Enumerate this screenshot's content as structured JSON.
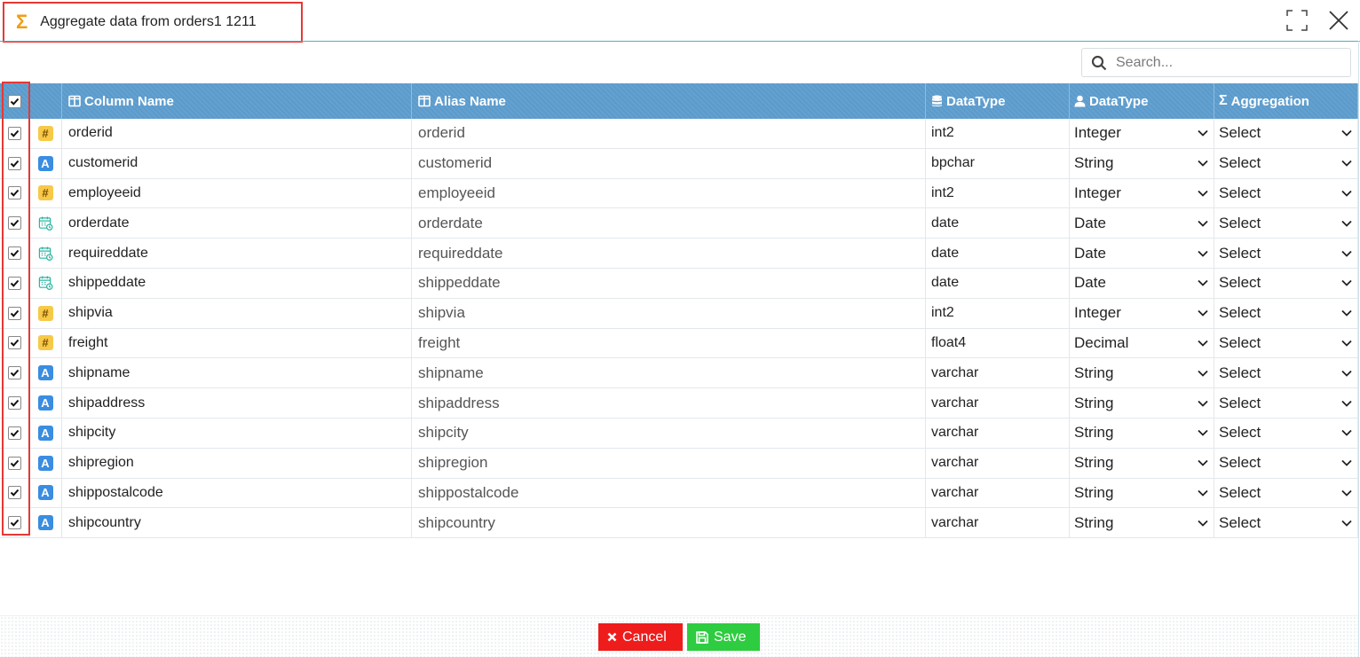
{
  "dialog": {
    "title": "Aggregate data from orders1 1211"
  },
  "search": {
    "placeholder": "Search..."
  },
  "table": {
    "headers": {
      "column_name": "Column Name",
      "alias_name": "Alias Name",
      "data_type": "DataType",
      "data_type2": "DataType",
      "aggregation": "Aggregation"
    },
    "rows": [
      {
        "type_icon": "hash-icon",
        "column": "orderid",
        "alias": "orderid",
        "db_type": "int2",
        "data_type": "Integer",
        "aggregation": "Select"
      },
      {
        "type_icon": "string-icon",
        "column": "customerid",
        "alias": "customerid",
        "db_type": "bpchar",
        "data_type": "String",
        "aggregation": "Select"
      },
      {
        "type_icon": "hash-icon",
        "column": "employeeid",
        "alias": "employeeid",
        "db_type": "int2",
        "data_type": "Integer",
        "aggregation": "Select"
      },
      {
        "type_icon": "calendar-icon",
        "column": "orderdate",
        "alias": "orderdate",
        "db_type": "date",
        "data_type": "Date",
        "aggregation": "Select"
      },
      {
        "type_icon": "calendar-icon",
        "column": "requireddate",
        "alias": "requireddate",
        "db_type": "date",
        "data_type": "Date",
        "aggregation": "Select"
      },
      {
        "type_icon": "calendar-icon",
        "column": "shippeddate",
        "alias": "shippeddate",
        "db_type": "date",
        "data_type": "Date",
        "aggregation": "Select"
      },
      {
        "type_icon": "hash-icon",
        "column": "shipvia",
        "alias": "shipvia",
        "db_type": "int2",
        "data_type": "Integer",
        "aggregation": "Select"
      },
      {
        "type_icon": "hash-icon",
        "column": "freight",
        "alias": "freight",
        "db_type": "float4",
        "data_type": "Decimal",
        "aggregation": "Select"
      },
      {
        "type_icon": "string-icon",
        "column": "shipname",
        "alias": "shipname",
        "db_type": "varchar",
        "data_type": "String",
        "aggregation": "Select"
      },
      {
        "type_icon": "string-icon",
        "column": "shipaddress",
        "alias": "shipaddress",
        "db_type": "varchar",
        "data_type": "String",
        "aggregation": "Select"
      },
      {
        "type_icon": "string-icon",
        "column": "shipcity",
        "alias": "shipcity",
        "db_type": "varchar",
        "data_type": "String",
        "aggregation": "Select"
      },
      {
        "type_icon": "string-icon",
        "column": "shipregion",
        "alias": "shipregion",
        "db_type": "varchar",
        "data_type": "String",
        "aggregation": "Select"
      },
      {
        "type_icon": "string-icon",
        "column": "shippostalcode",
        "alias": "shippostalcode",
        "db_type": "varchar",
        "data_type": "String",
        "aggregation": "Select"
      },
      {
        "type_icon": "string-icon",
        "column": "shipcountry",
        "alias": "shipcountry",
        "db_type": "varchar",
        "data_type": "String",
        "aggregation": "Select"
      }
    ]
  },
  "footer": {
    "cancel_label": "Cancel",
    "save_label": "Save"
  },
  "colors": {
    "header_bg": "#5b9bcc",
    "accent_orange": "#f39c12",
    "cancel_red": "#ef1c1c",
    "save_green": "#2ecc40",
    "highlight_red": "#e53935"
  }
}
